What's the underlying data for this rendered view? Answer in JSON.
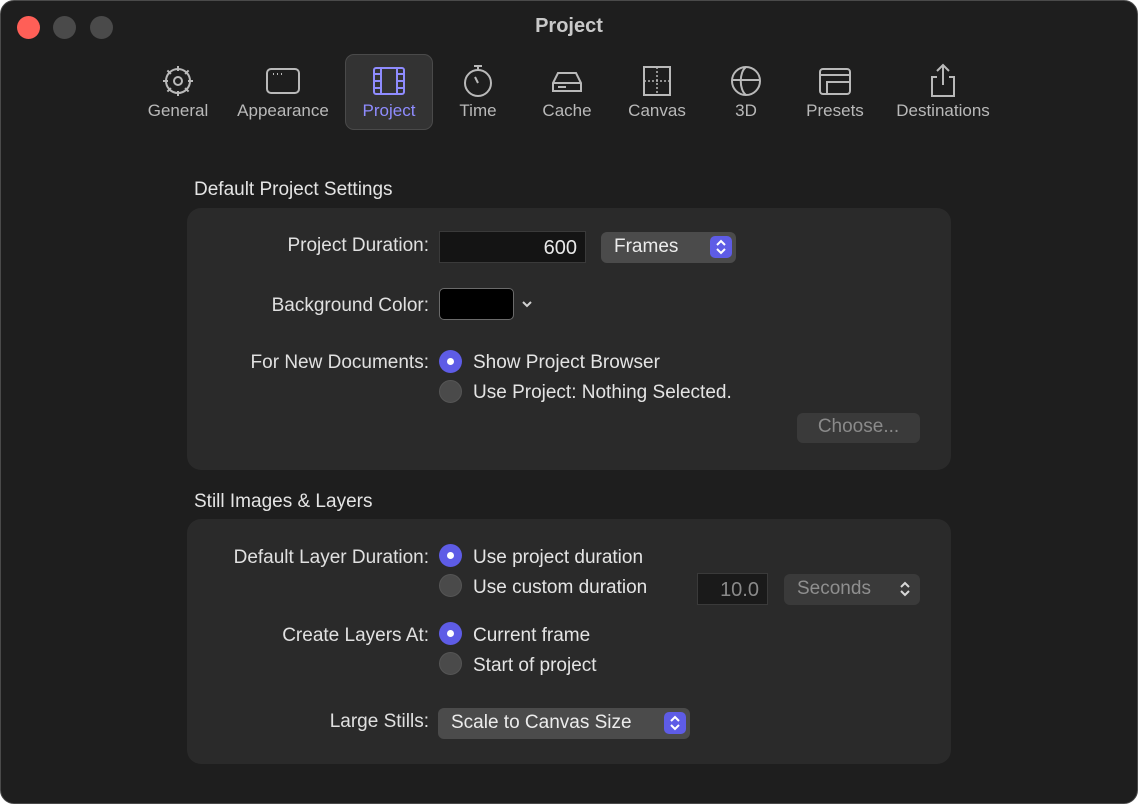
{
  "window": {
    "title": "Project"
  },
  "toolbar": {
    "items": [
      {
        "label": "General",
        "icon": "gear-icon"
      },
      {
        "label": "Appearance",
        "icon": "window-icon"
      },
      {
        "label": "Project",
        "icon": "film-icon",
        "selected": true
      },
      {
        "label": "Time",
        "icon": "stopwatch-icon"
      },
      {
        "label": "Cache",
        "icon": "drive-icon"
      },
      {
        "label": "Canvas",
        "icon": "canvas-icon"
      },
      {
        "label": "3D",
        "icon": "globe-icon"
      },
      {
        "label": "Presets",
        "icon": "presets-icon"
      },
      {
        "label": "Destinations",
        "icon": "share-icon"
      }
    ]
  },
  "default_project": {
    "title": "Default Project Settings",
    "duration_label": "Project Duration:",
    "duration_value": "600",
    "duration_unit": "Frames",
    "bg_label": "Background Color:",
    "bg_color": "#000000",
    "new_docs_label": "For New Documents:",
    "option_browser": "Show Project Browser",
    "option_use_project": "Use Project: Nothing Selected.",
    "choose_button": "Choose..."
  },
  "still_images": {
    "title": "Still Images & Layers",
    "layer_duration_label": "Default Layer Duration:",
    "option_project_duration": "Use project duration",
    "option_custom_duration": "Use custom duration",
    "custom_value": "10.0",
    "custom_unit": "Seconds",
    "create_at_label": "Create Layers At:",
    "option_current_frame": "Current frame",
    "option_start": "Start of project",
    "large_stills_label": "Large Stills:",
    "large_stills_value": "Scale to Canvas Size"
  },
  "colors": {
    "accent": "#5e5ce6",
    "close": "#ff5f57"
  }
}
